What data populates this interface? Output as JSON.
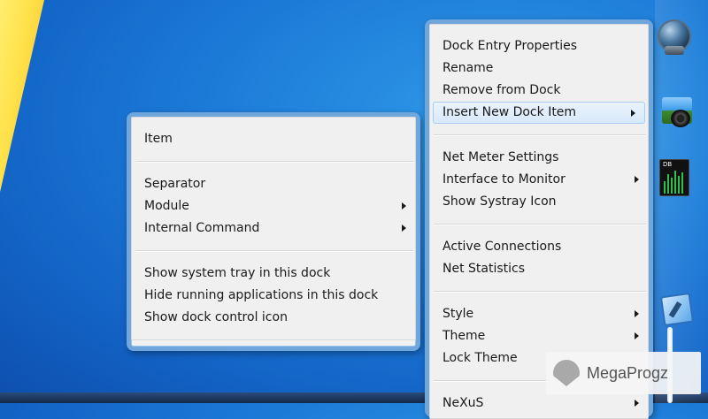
{
  "left_menu": {
    "items": [
      {
        "label": "Item"
      },
      {
        "label": "Separator"
      },
      {
        "label": "Module"
      },
      {
        "label": "Internal Command"
      },
      {
        "label": "Show system tray in this dock"
      },
      {
        "label": "Hide running applications in this dock"
      },
      {
        "label": "Show dock control icon"
      }
    ]
  },
  "right_menu": {
    "items": [
      {
        "label": "Dock Entry Properties"
      },
      {
        "label": "Rename"
      },
      {
        "label": "Remove from Dock"
      },
      {
        "label": "Insert New Dock Item"
      },
      {
        "label": "Net Meter Settings"
      },
      {
        "label": "Interface to Monitor"
      },
      {
        "label": "Show Systray Icon"
      },
      {
        "label": "Active Connections"
      },
      {
        "label": "Net Statistics"
      },
      {
        "label": "Style"
      },
      {
        "label": "Theme"
      },
      {
        "label": "Lock Theme"
      },
      {
        "label": "NeXuS"
      }
    ]
  },
  "dock": {
    "netmeter_label": "DB"
  },
  "watermark": {
    "text": "MegaProgz"
  },
  "colors": {
    "menu_border": "#6fa6dc",
    "highlight": "#d8e9fb",
    "desktop": "#1b78d6"
  }
}
